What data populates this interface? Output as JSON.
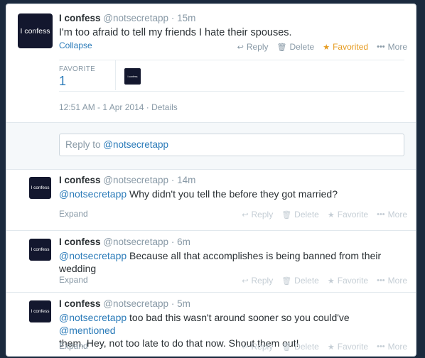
{
  "tweet": {
    "avatar_text": "I confess",
    "name": "I confess",
    "handle": "@notsecretapp",
    "separator": "·",
    "time": "15m",
    "text": "I'm too afraid to tell my friends I hate their spouses.",
    "collapse_label": "Collapse",
    "actions": {
      "reply": "Reply",
      "delete": "Delete",
      "favorited": "Favorited",
      "more": "More"
    },
    "stats": {
      "favorite_label": "FAVORITE",
      "favorite_count": "1",
      "favoriter_avatar_text": "I confess"
    },
    "timestamp": "12:51 AM - 1 Apr 2014",
    "details_label": "Details",
    "timestamp_separator": " · "
  },
  "reply_box": {
    "prefix": "Reply to ",
    "mention": "@notsecretapp"
  },
  "replies": [
    {
      "avatar_text": "I confess",
      "name": "I confess",
      "handle": "@notsecretapp",
      "separator": "·",
      "time": "14m",
      "mention": "@notsecretapp",
      "text": " Why didn't you tell the before they got married?",
      "text_line2": "",
      "expand_label": "Expand"
    },
    {
      "avatar_text": "I confess",
      "name": "I confess",
      "handle": "@notsecretapp",
      "separator": "·",
      "time": "6m",
      "mention": "@notsecretapp",
      "text": " Because all that accomplishes is being banned from their",
      "text_line2": "wedding",
      "expand_label": "Expand"
    },
    {
      "avatar_text": "I confess",
      "name": "I confess",
      "handle": "@notsecretapp",
      "separator": "·",
      "time": "5m",
      "mention": "@notsecretapp",
      "text": " too bad this wasn't around sooner so you could've ",
      "mention2": "@mentioned",
      "text_line2": "them. Hey, not too late to do that now. Shout them out!",
      "expand_label": "Expand"
    }
  ],
  "reply_actions": {
    "reply": "Reply",
    "delete": "Delete",
    "favorite": "Favorite",
    "more": "More"
  },
  "colors": {
    "background": "#1b2a3e",
    "link": "#2b7bb9",
    "favorited": "#e69b1f",
    "avatar": "#13172e"
  },
  "icons": {
    "reply": "reply-arrow-icon",
    "delete": "trash-icon",
    "favorite": "star-icon",
    "more": "more-dots-icon"
  }
}
